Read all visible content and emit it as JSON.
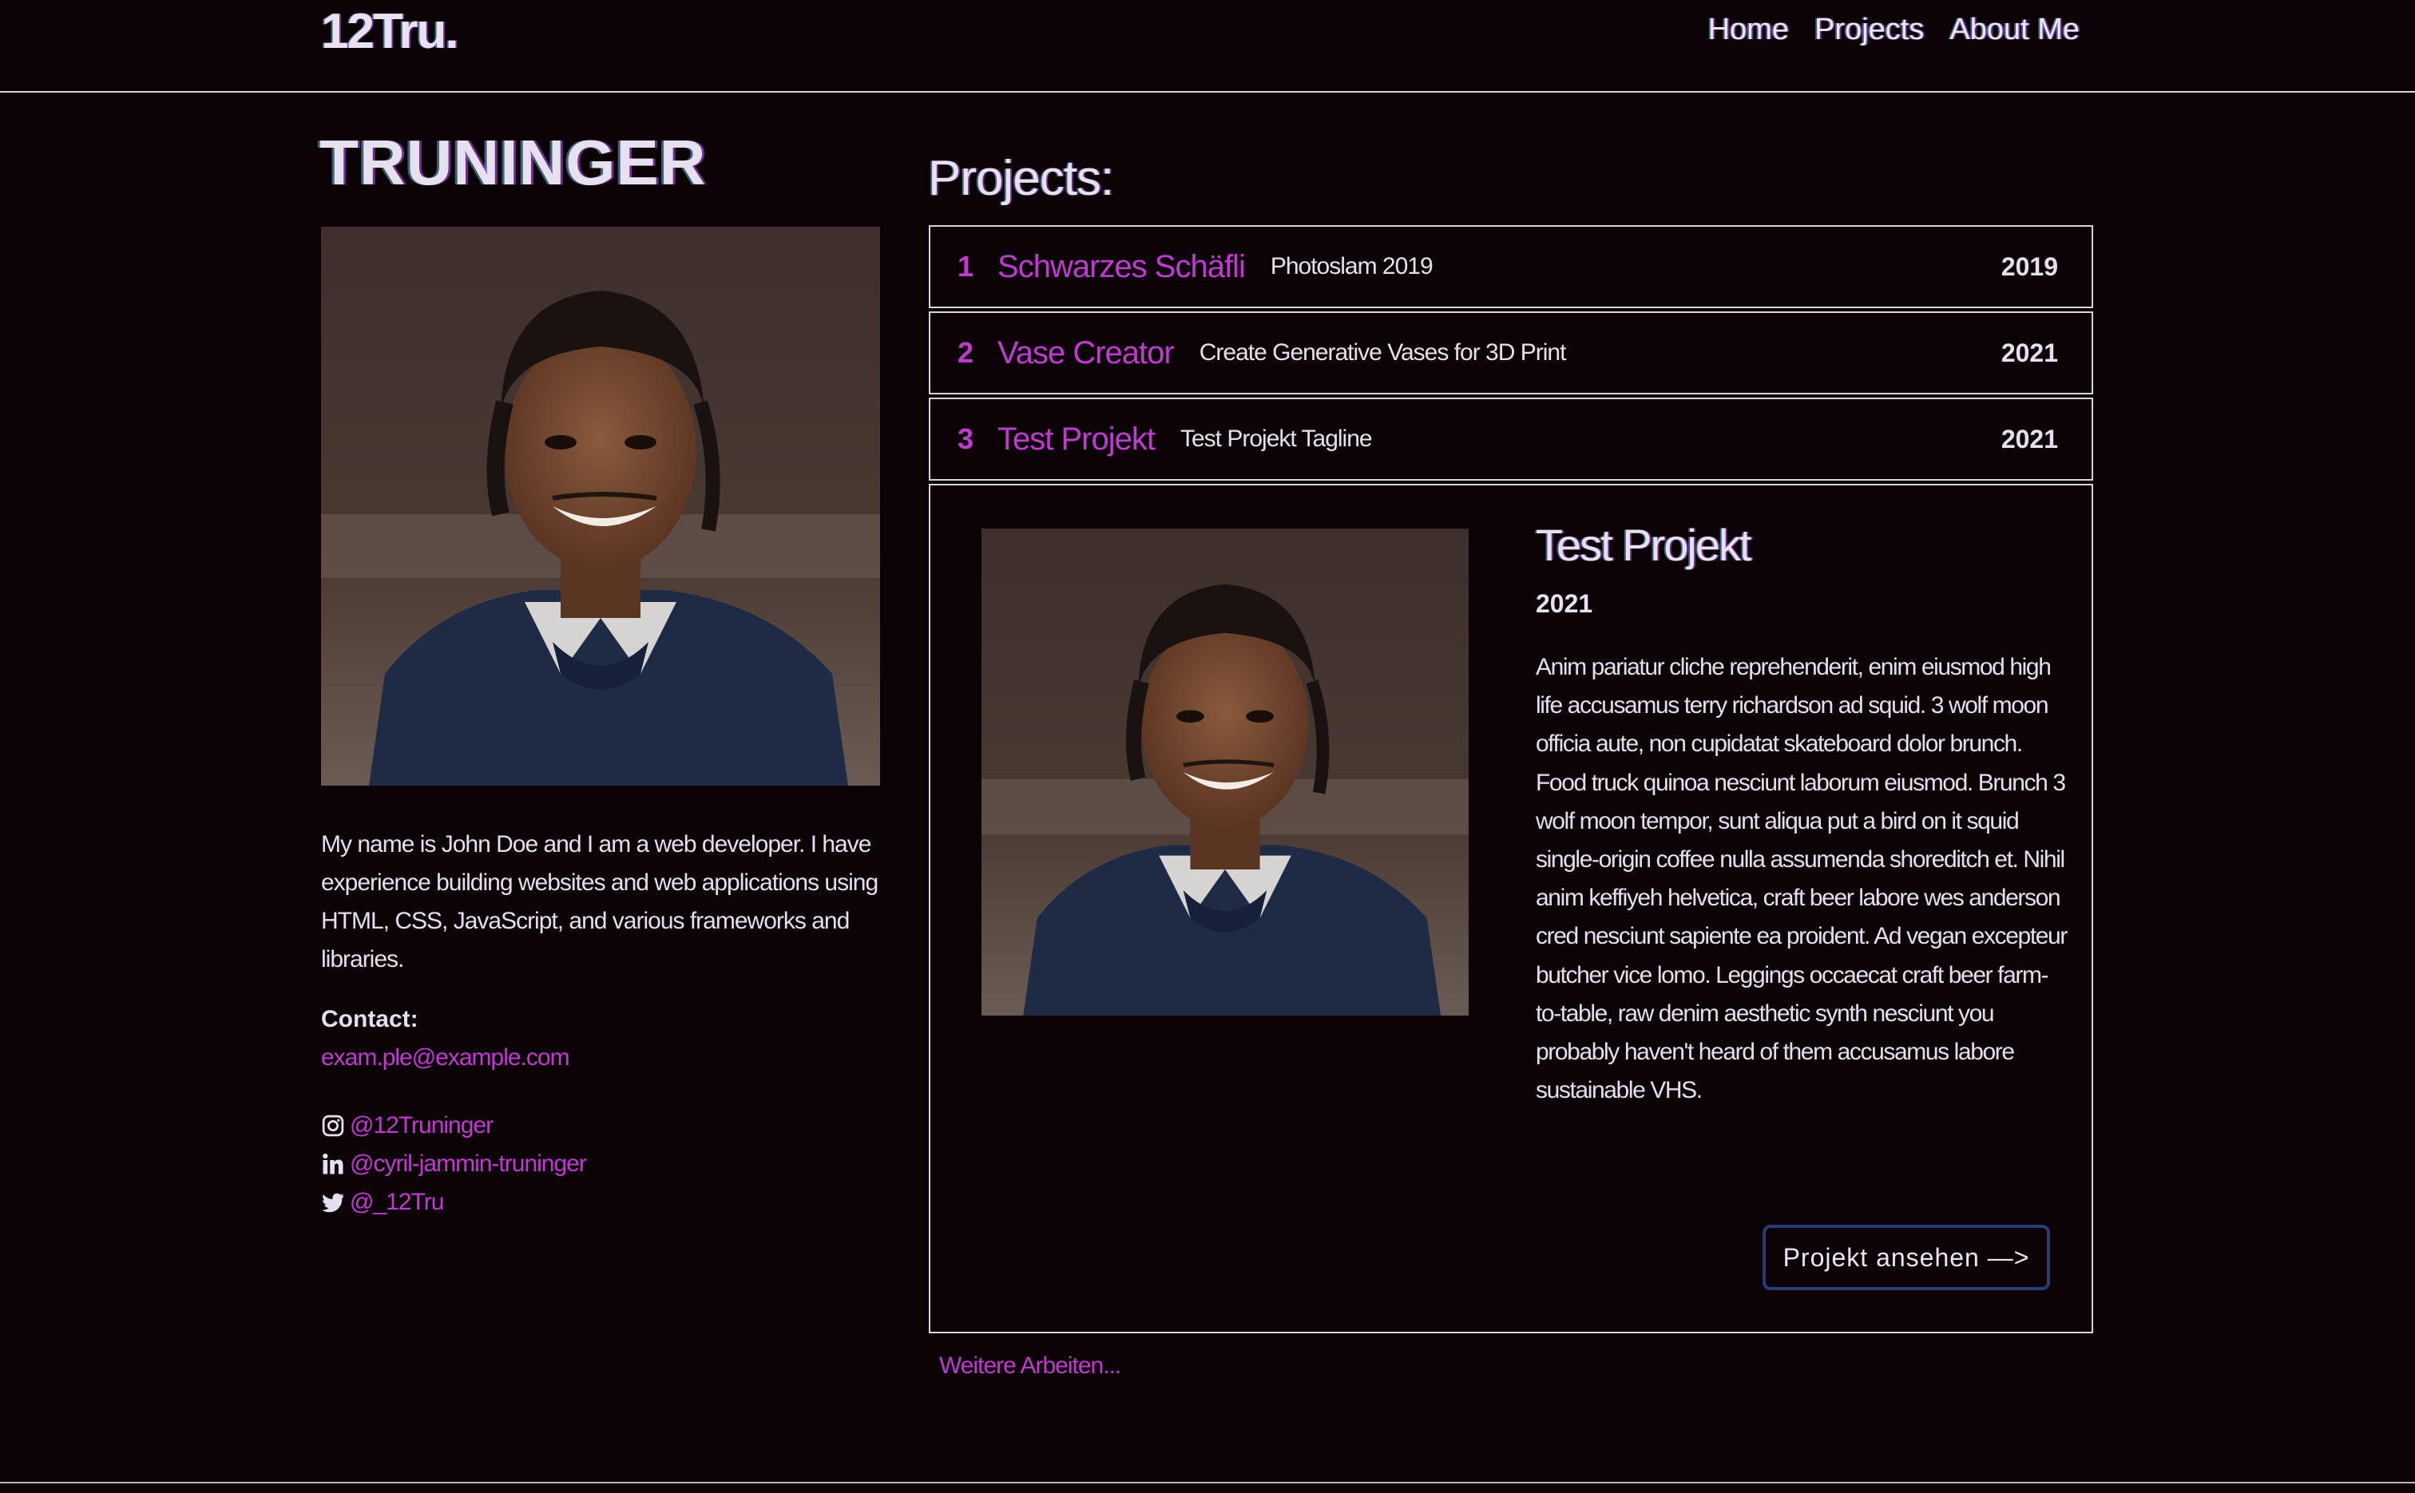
{
  "header": {
    "logo": "12Tru.",
    "nav": [
      "Home",
      "Projects",
      "About Me"
    ]
  },
  "profile": {
    "name": "TRUNINGER",
    "bio": "My name is John Doe and I am a web developer. I have experience building websites and web applications using HTML, CSS, JavaScript, and various frameworks and libraries.",
    "contact_label": "Contact:",
    "email": "exam.ple@example.com",
    "socials": [
      {
        "icon": "instagram-icon",
        "handle": "@12Truninger"
      },
      {
        "icon": "linkedin-icon",
        "handle": "@cyril-jammin-truninger"
      },
      {
        "icon": "twitter-icon",
        "handle": "@_12Tru"
      }
    ]
  },
  "projects": {
    "heading": "Projects:",
    "items": [
      {
        "num": "1",
        "title": "Schwarzes Schäfli",
        "tagline": "Photoslam 2019",
        "year": "2019"
      },
      {
        "num": "2",
        "title": "Vase Creator",
        "tagline": "Create Generative Vases for 3D Print",
        "year": "2021"
      },
      {
        "num": "3",
        "title": "Test Projekt",
        "tagline": "Test Projekt Tagline",
        "year": "2021"
      }
    ],
    "detail": {
      "title": "Test Projekt",
      "year": "2021",
      "description": "Anim pariatur cliche reprehenderit, enim eiusmod high life accusamus terry richardson ad squid. 3 wolf moon officia aute, non cupidatat skateboard dolor brunch. Food truck quinoa nesciunt laborum eiusmod. Brunch 3 wolf moon tempor, sunt aliqua put a bird on it squid single-origin coffee nulla assumenda shoreditch et. Nihil anim keffiyeh helvetica, craft beer labore wes anderson cred nesciunt sapiente ea proident. Ad vegan excepteur butcher vice lomo. Leggings occaecat craft beer farm-to-table, raw denim aesthetic synth nesciunt you probably haven't heard of them accusamus labore sustainable VHS.",
      "button": "Projekt ansehen —>"
    },
    "more": "Weitere Arbeiten..."
  },
  "colors": {
    "background": "#0c0306",
    "accent": "#c238d3",
    "text": "#e6dff0",
    "button_border": "#2a3c78"
  }
}
